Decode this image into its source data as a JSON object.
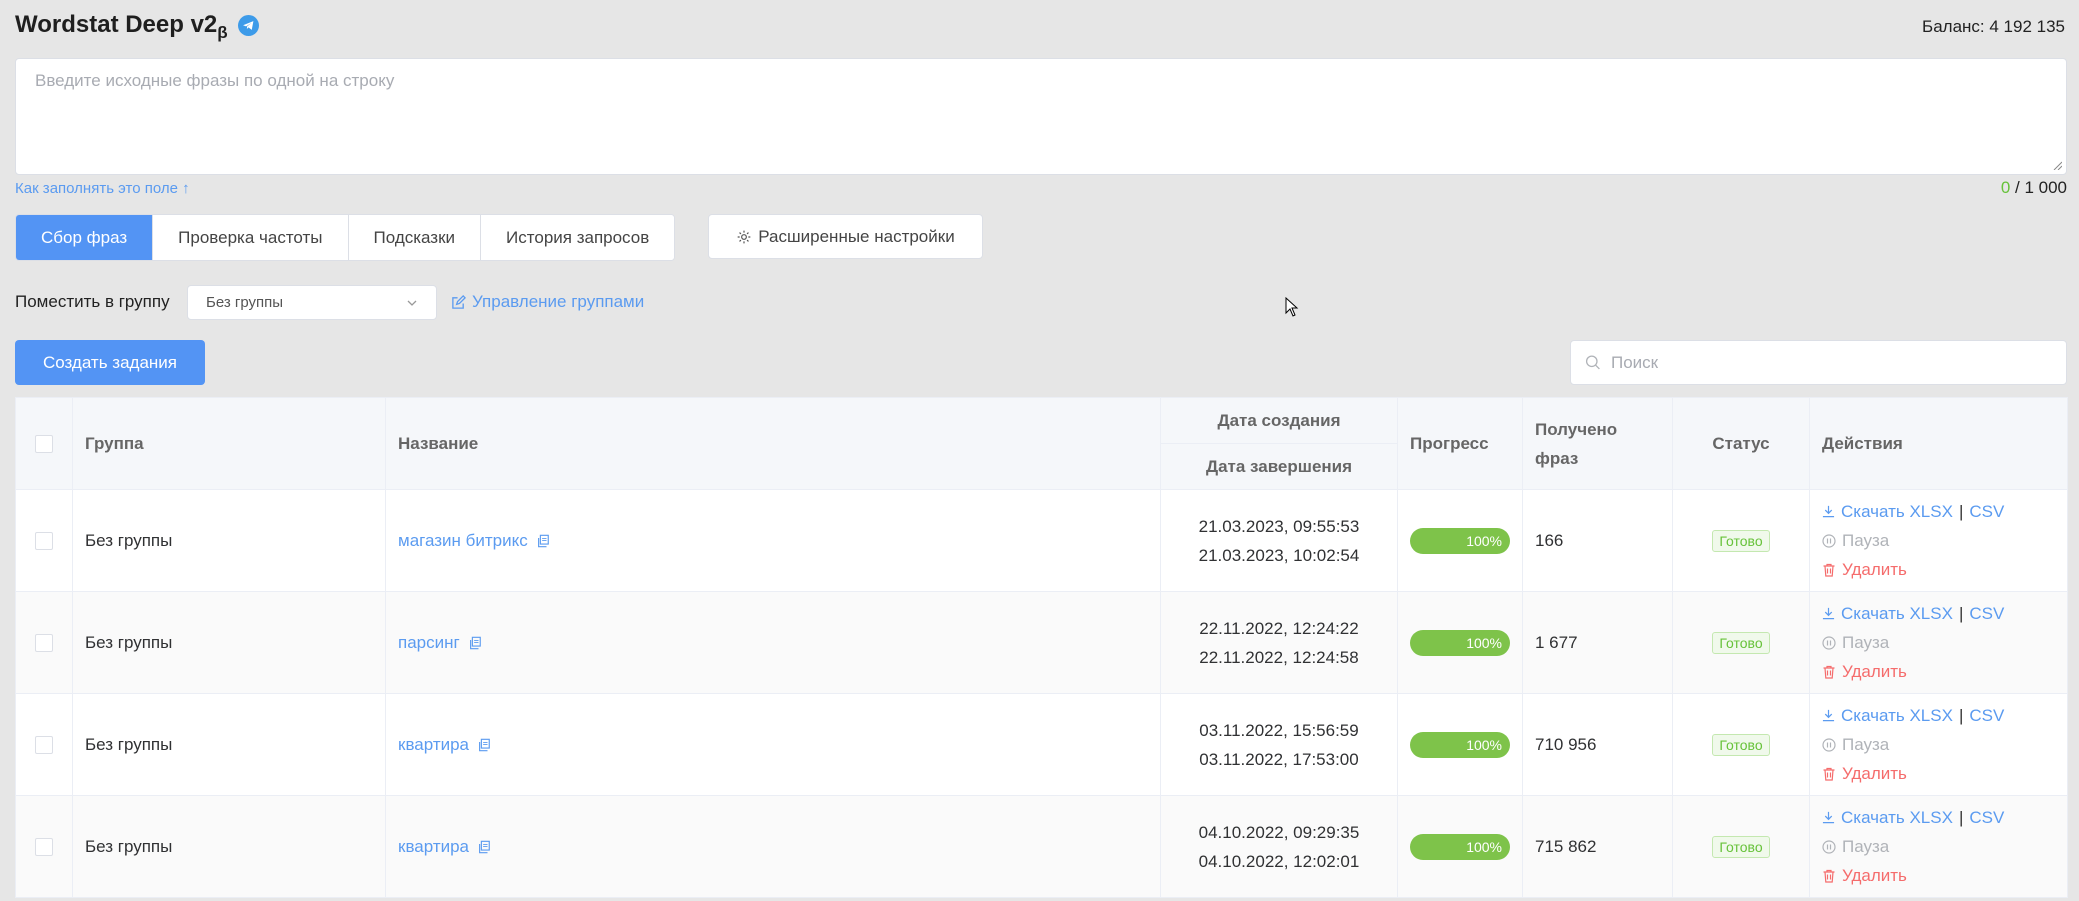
{
  "header": {
    "title": "Wordstat Deep v2",
    "title_sub": "β",
    "balance": "Баланс: 4 192 135"
  },
  "input": {
    "placeholder": "Введите исходные фразы по одной на строку",
    "help_link": "Как заполнять это поле ↑",
    "counter_current": "0",
    "counter_max": " / 1 000"
  },
  "tabs": [
    {
      "label": "Сбор фраз"
    },
    {
      "label": "Проверка частоты"
    },
    {
      "label": "Подсказки"
    },
    {
      "label": "История запросов"
    }
  ],
  "advanced_settings": "Расширенные настройки",
  "group": {
    "label": "Поместить в группу",
    "selected": "Без группы",
    "manage": "Управление группами"
  },
  "create_button": "Создать задания",
  "search": {
    "placeholder": "Поиск"
  },
  "table": {
    "headers": {
      "group": "Группа",
      "name": "Название",
      "created": "Дата создания",
      "finished": "Дата завершения",
      "progress": "Прогресс",
      "received": "Получено фраз",
      "status": "Статус",
      "actions": "Действия"
    },
    "action_labels": {
      "download": "Скачать XLSX",
      "sep": "|",
      "csv": "CSV",
      "pause": "Пауза",
      "delete": "Удалить"
    },
    "rows": [
      {
        "group": "Без группы",
        "name": "магазин битрикс",
        "created": "21.03.2023, 09:55:53",
        "finished": "21.03.2023, 10:02:54",
        "progress": "100%",
        "received": "166",
        "status": "Готово"
      },
      {
        "group": "Без группы",
        "name": "парсинг",
        "created": "22.11.2022, 12:24:22",
        "finished": "22.11.2022, 12:24:58",
        "progress": "100%",
        "received": "1 677",
        "status": "Готово"
      },
      {
        "group": "Без группы",
        "name": "квартира",
        "created": "03.11.2022, 15:56:59",
        "finished": "03.11.2022, 17:53:00",
        "progress": "100%",
        "received": "710 956",
        "status": "Готово"
      },
      {
        "group": "Без группы",
        "name": "квартира",
        "created": "04.10.2022, 09:29:35",
        "finished": "04.10.2022, 12:02:01",
        "progress": "100%",
        "received": "715 862",
        "status": "Готово"
      }
    ]
  },
  "colors": {
    "accent": "#5394f4",
    "success": "#7ec34a",
    "danger": "#f56c6c",
    "background": "#e6e6e6"
  }
}
